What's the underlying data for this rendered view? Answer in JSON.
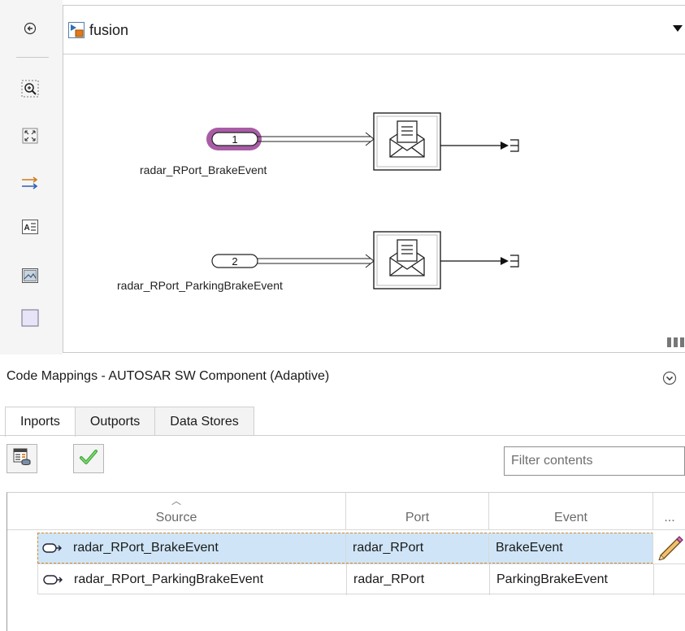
{
  "palette": {
    "icons": [
      "back-arrow-icon",
      "zoom-in-icon",
      "fit-to-view-icon",
      "signal-line-icon",
      "annotation-icon",
      "image-icon",
      "area-box-icon"
    ]
  },
  "breadcrumb": {
    "model_name": "fusion"
  },
  "diagram": {
    "blocks": [
      {
        "port_number": "1",
        "signal_label": "radar_RPort_BrakeEvent"
      },
      {
        "port_number": "2",
        "signal_label": "radar_RPort_ParkingBrakeEvent"
      }
    ],
    "colors": {
      "selection_highlight": "#a04a9c"
    }
  },
  "code_mappings": {
    "title": "Code Mappings - AUTOSAR SW Component (Adaptive)",
    "tabs": [
      "Inports",
      "Outports",
      "Data Stores"
    ],
    "active_tab": "Inports",
    "filter_placeholder": "Filter contents",
    "table": {
      "headers": [
        "Source",
        "Port",
        "Event",
        "..."
      ],
      "rows": [
        {
          "source": "radar_RPort_BrakeEvent",
          "port": "radar_RPort",
          "event": "BrakeEvent",
          "selected": true
        },
        {
          "source": "radar_RPort_ParkingBrakeEvent",
          "port": "radar_RPort",
          "event": "ParkingBrakeEvent",
          "selected": false
        }
      ]
    },
    "colors": {
      "selected_row": "#cfe5f7",
      "check_green": "#3aa83a"
    }
  }
}
